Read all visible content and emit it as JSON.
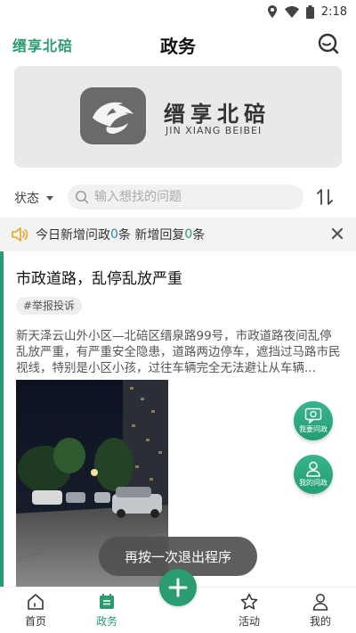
{
  "status_bar": {
    "time": "2:18"
  },
  "header": {
    "brand": "缙享北碚",
    "title": "政务"
  },
  "banner": {
    "cn_text": "缙享北碚",
    "en_text": "JIN XIANG BEIBEI"
  },
  "filter": {
    "status_label": "状态",
    "search_placeholder": "输入想找的问题"
  },
  "notice": {
    "prefix": "今日新增问政",
    "new_count": "0",
    "mid": "条 新增回复",
    "reply_count": "0",
    "suffix": "条"
  },
  "post": {
    "title": "市政道路，乱停乱放严重",
    "tag": "#举报投诉",
    "description": "新天泽云山外小区—北碚区缙泉路99号，市政道路夜间乱停乱放严重，有严重安全隐患，道路两边停车，遮挡过马路市民视线，特别是小区小孩，过往车辆完全无法避让从车辆..."
  },
  "floating": {
    "ask_label": "我要问政",
    "my_label": "我的问政"
  },
  "toast": "再按一次退出程序",
  "nav": {
    "home": "首页",
    "gov": "政务",
    "activity": "活动",
    "mine": "我的"
  },
  "colors": {
    "accent": "#2a9c70",
    "banner_bg": "#e9e9e9"
  }
}
